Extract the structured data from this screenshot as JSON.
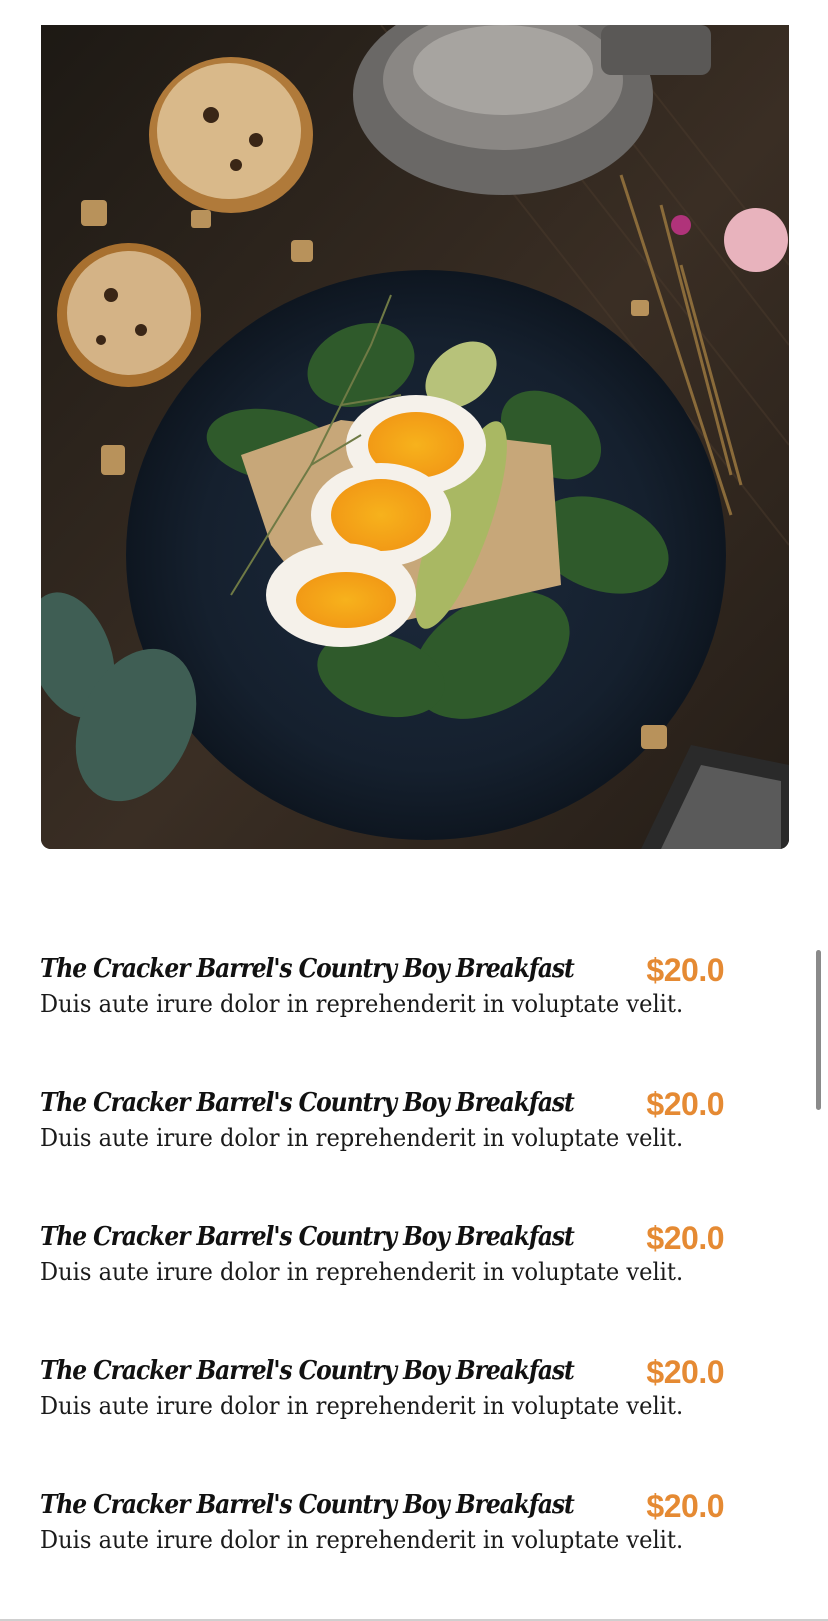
{
  "hero_image": {
    "alt": "",
    "description_icon": "food-photo"
  },
  "menu": {
    "items": [
      {
        "title": "The Cracker Barrel's Country Boy Breakfast",
        "price": "$20.0",
        "description": "Duis aute irure dolor in reprehenderit in voluptate velit."
      },
      {
        "title": "The Cracker Barrel's Country Boy Breakfast",
        "price": "$20.0",
        "description": "Duis aute irure dolor in reprehenderit in voluptate velit."
      },
      {
        "title": "The Cracker Barrel's Country Boy Breakfast",
        "price": "$20.0",
        "description": "Duis aute irure dolor in reprehenderit in voluptate velit."
      },
      {
        "title": "The Cracker Barrel's Country Boy Breakfast",
        "price": "$20.0",
        "description": "Duis aute irure dolor in reprehenderit in voluptate velit."
      },
      {
        "title": "The Cracker Barrel's Country Boy Breakfast",
        "price": "$20.0",
        "description": "Duis aute irure dolor in reprehenderit in voluptate velit."
      }
    ]
  },
  "colors": {
    "price": "#e58a33",
    "title": "#111111",
    "description": "#1a1a1a"
  }
}
